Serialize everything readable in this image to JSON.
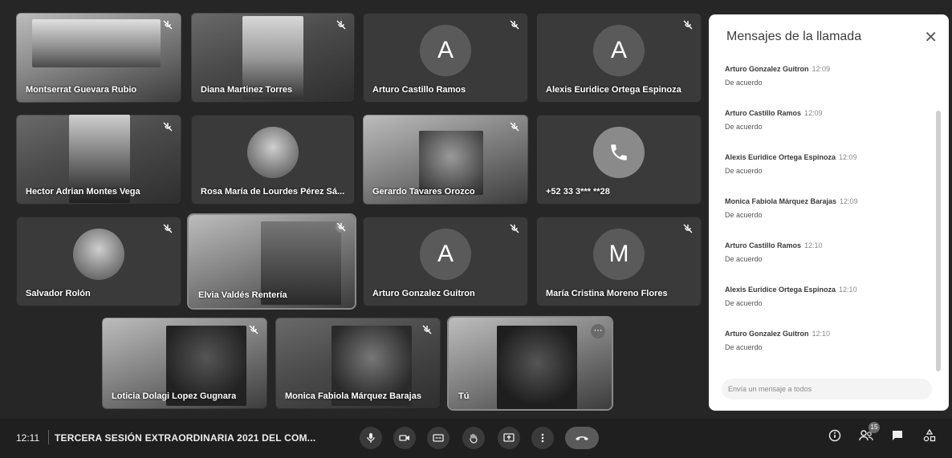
{
  "participants": [
    {
      "name": "Montserrat Guevara Rubio"
    },
    {
      "name": "Diana Martinez Torres"
    },
    {
      "name": "Arturo Castillo Ramos",
      "initial": "A"
    },
    {
      "name": "Alexis Euridice Ortega Espinoza",
      "initial": "A"
    },
    {
      "name": "Hector Adrian Montes Vega"
    },
    {
      "name": "Rosa María de Lourdes Pérez Sá..."
    },
    {
      "name": "Gerardo Tavares Orozco"
    },
    {
      "name": "+52 33 3*** **28"
    },
    {
      "name": "Salvador Rolón"
    },
    {
      "name": "Elvia Valdés Rentería"
    },
    {
      "name": "Arturo Gonzalez Guitron",
      "initial": "A"
    },
    {
      "name": "María Cristina Moreno Flores",
      "initial": "M"
    },
    {
      "name": "Loticia Dolagi Lopez Gugnara"
    },
    {
      "name": "Monica Fabiola Márquez Barajas"
    },
    {
      "name": "Tú"
    }
  ],
  "chat": {
    "title": "Mensajes de la llamada",
    "close_icon": "close-icon",
    "messages": [
      {
        "sender": "Arturo Gonzalez Guitron",
        "time": "12:09",
        "text": "De acuerdo"
      },
      {
        "sender": "Arturo Castillo Ramos",
        "time": "12:09",
        "text": "De acuerdo"
      },
      {
        "sender": "Alexis Euridice Ortega Espinoza",
        "time": "12:09",
        "text": "De acuerdo"
      },
      {
        "sender": "Monica Fabiola Márquez Barajas",
        "time": "12:09",
        "text": "De acuerdo"
      },
      {
        "sender": "Arturo Castillo Ramos",
        "time": "12:10",
        "text": "De acuerdo"
      },
      {
        "sender": "Alexis Euridice Ortega Espinoza",
        "time": "12:10",
        "text": "De acuerdo"
      },
      {
        "sender": "Arturo Gonzalez Guitron",
        "time": "12:10",
        "text": "De acuerdo"
      }
    ],
    "input_placeholder": "Envía un mensaje a todos"
  },
  "bottom_bar": {
    "time": "12:11",
    "meeting_title": "TERCERA SESIÓN EXTRAORDINARIA 2021 DEL COM...",
    "participants_badge": "15"
  }
}
